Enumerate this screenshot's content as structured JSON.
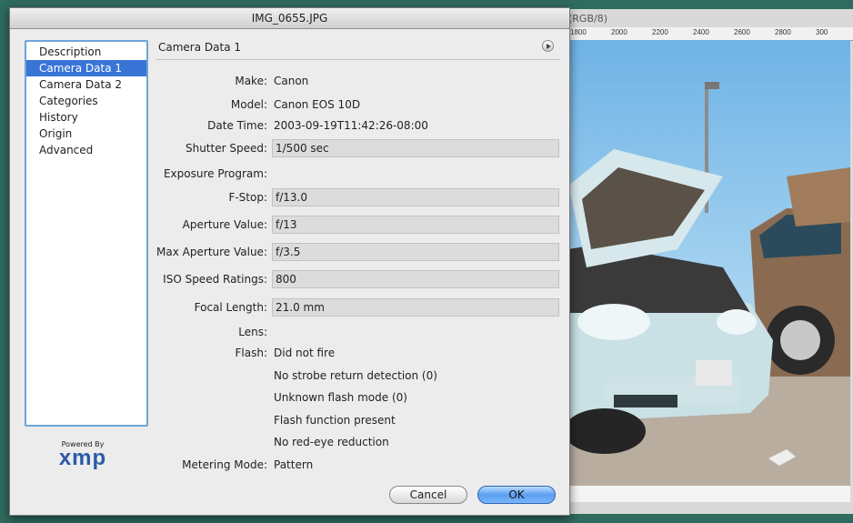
{
  "dialog": {
    "title": "IMG_0655.JPG",
    "nav_items": [
      "Description",
      "Camera Data 1",
      "Camera Data 2",
      "Categories",
      "History",
      "Origin",
      "Advanced"
    ],
    "selected_nav": 1,
    "panel_title": "Camera Data 1",
    "logo_powered": "Powered By",
    "logo_name": "xmp",
    "fields": {
      "make_label": "Make:",
      "make": "Canon",
      "model_label": "Model:",
      "model": "Canon EOS 10D",
      "datetime_label": "Date Time:",
      "datetime": "2003-09-19T11:42:26-08:00",
      "shutter_label": "Shutter Speed:",
      "shutter": "1/500 sec",
      "exposure_label": "Exposure Program:",
      "exposure": "",
      "fstop_label": "F-Stop:",
      "fstop": "f/13.0",
      "aperture_label": "Aperture Value:",
      "aperture": "f/13",
      "maxaperture_label": "Max Aperture Value:",
      "maxaperture": "f/3.5",
      "iso_label": "ISO Speed Ratings:",
      "iso": "800",
      "focal_label": "Focal Length:",
      "focal": "21.0 mm",
      "lens_label": "Lens:",
      "lens": "",
      "flash_label": "Flash:",
      "flash": [
        "Did not fire",
        "No strobe return detection (0)",
        "Unknown flash mode (0)",
        "Flash function present",
        "No red-eye reduction"
      ],
      "metering_label": "Metering Mode:",
      "metering": "Pattern"
    },
    "buttons": {
      "cancel": "Cancel",
      "ok": "OK"
    }
  },
  "background_window": {
    "title_fragment": "(RGB/8)",
    "ruler_ticks": [
      "1800",
      "2000",
      "2200",
      "2400",
      "2600",
      "2800",
      "300"
    ]
  }
}
